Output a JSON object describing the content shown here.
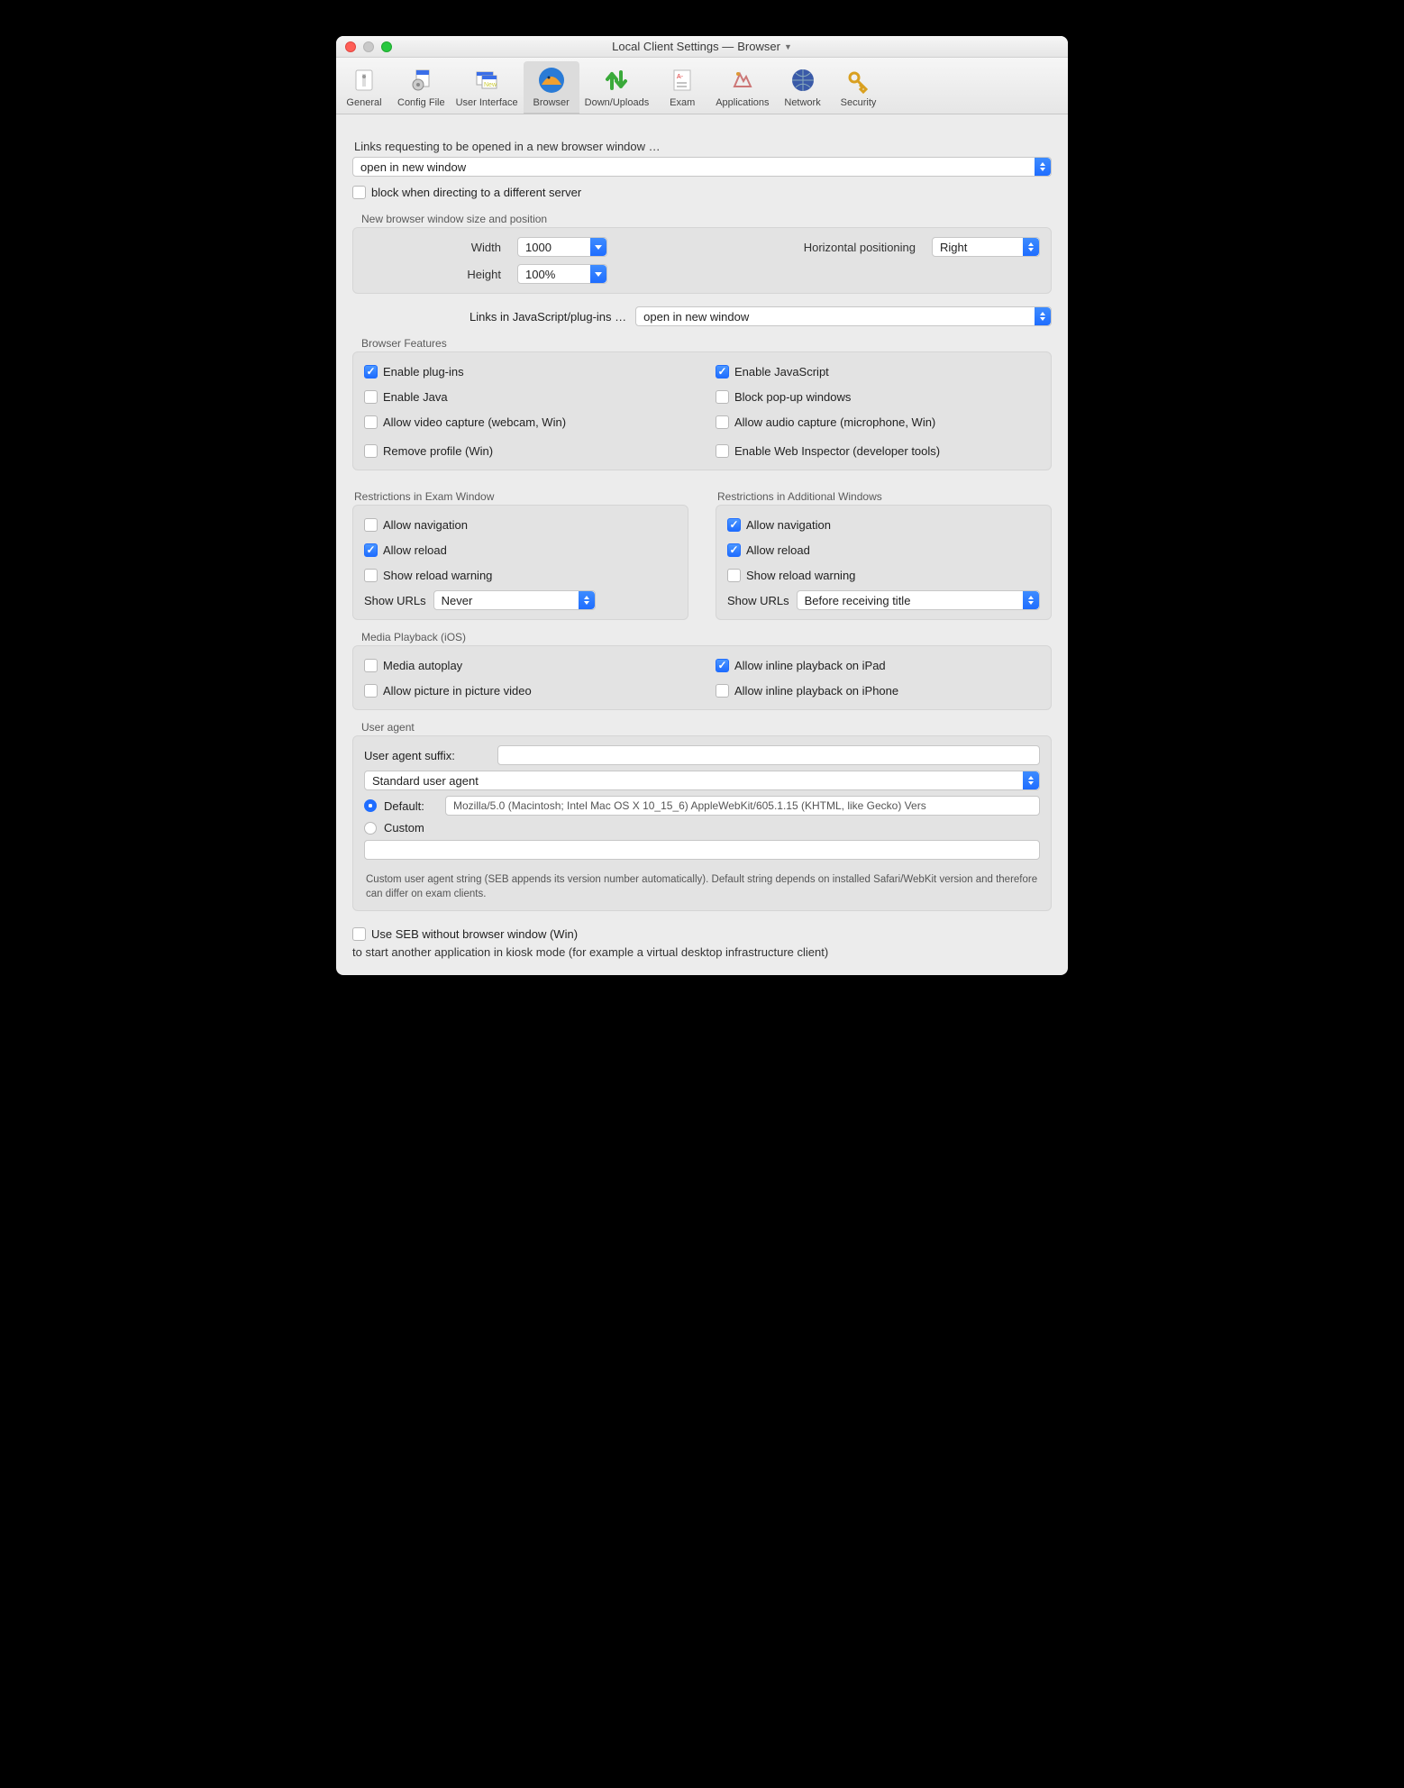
{
  "title": {
    "prefix": "Local Client Settings  —  ",
    "section": "Browser"
  },
  "toolbar": {
    "items": [
      {
        "label": "General"
      },
      {
        "label": "Config File"
      },
      {
        "label": "User Interface"
      },
      {
        "label": "Browser"
      },
      {
        "label": "Down/Uploads"
      },
      {
        "label": "Exam"
      },
      {
        "label": "Applications"
      },
      {
        "label": "Network"
      },
      {
        "label": "Security"
      }
    ]
  },
  "links": {
    "heading": "Links requesting to be opened in a new browser window …",
    "open_policy": "open in new window",
    "block_different_server": "block when directing to a different server"
  },
  "new_window": {
    "section": "New browser window size and position",
    "width_label": "Width",
    "width_value": "1000",
    "height_label": "Height",
    "height_value": "100%",
    "hpos_label": "Horizontal positioning",
    "hpos_value": "Right"
  },
  "js_links": {
    "label": "Links in JavaScript/plug-ins …",
    "value": "open in new window"
  },
  "features": {
    "section": "Browser Features",
    "left": [
      {
        "label": "Enable plug-ins",
        "on": true
      },
      {
        "label": "Enable Java",
        "on": false
      },
      {
        "label": "Allow video capture (webcam, Win)",
        "on": false
      },
      {
        "label": "Remove profile (Win)",
        "on": false
      }
    ],
    "right": [
      {
        "label": "Enable JavaScript",
        "on": true
      },
      {
        "label": "Block pop-up windows",
        "on": false
      },
      {
        "label": "Allow audio capture (microphone, Win)",
        "on": false
      },
      {
        "label": "Enable Web Inspector (developer tools)",
        "on": false
      }
    ]
  },
  "restrictions_exam": {
    "section": "Restrictions in Exam Window",
    "items": [
      {
        "label": "Allow navigation",
        "on": false
      },
      {
        "label": "Allow reload",
        "on": true
      },
      {
        "label": "Show reload warning",
        "on": false
      }
    ],
    "show_urls_label": "Show URLs",
    "show_urls_value": "Never"
  },
  "restrictions_add": {
    "section": "Restrictions in Additional Windows",
    "items": [
      {
        "label": "Allow navigation",
        "on": true
      },
      {
        "label": "Allow reload",
        "on": true
      },
      {
        "label": "Show reload warning",
        "on": false
      }
    ],
    "show_urls_label": "Show URLs",
    "show_urls_value": "Before receiving title"
  },
  "media": {
    "section": "Media Playback (iOS)",
    "left": [
      {
        "label": "Media autoplay",
        "on": false
      },
      {
        "label": "Allow picture in picture video",
        "on": false
      }
    ],
    "right": [
      {
        "label": "Allow inline playback on iPad",
        "on": true
      },
      {
        "label": "Allow inline playback on iPhone",
        "on": false
      }
    ]
  },
  "ua": {
    "section": "User agent",
    "suffix_label": "User agent suffix:",
    "suffix_value": "",
    "preset": "Standard user agent",
    "default_label": "Default:",
    "default_value": "Mozilla/5.0 (Macintosh; Intel Mac OS X 10_15_6) AppleWebKit/605.1.15 (KHTML, like Gecko) Vers",
    "custom_label": "Custom",
    "custom_value": "",
    "note": "Custom user agent string (SEB appends its version number automatically). Default string depends on installed Safari/WebKit version and therefore can differ on exam clients."
  },
  "footer": {
    "use_seb_without": "Use SEB without browser window (Win)",
    "kiosk_note": "to start another application in kiosk mode (for example a virtual desktop infrastructure client)"
  }
}
